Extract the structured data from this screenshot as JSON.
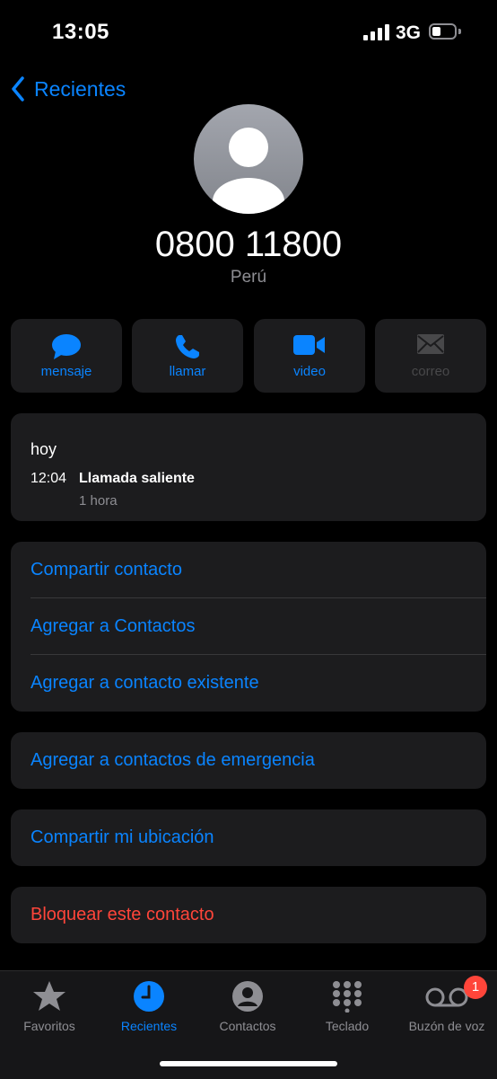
{
  "status_bar": {
    "time": "13:05",
    "network": "3G",
    "battery_level": 0.4
  },
  "nav": {
    "back_label": "Recientes"
  },
  "contact": {
    "number": "0800 11800",
    "country": "Perú"
  },
  "actions": [
    {
      "label": "mensaje",
      "icon": "message-bubble-icon",
      "enabled": true
    },
    {
      "label": "llamar",
      "icon": "phone-icon",
      "enabled": true
    },
    {
      "label": "video",
      "icon": "video-camera-icon",
      "enabled": true
    },
    {
      "label": "correo",
      "icon": "mail-envelope-icon",
      "enabled": false
    }
  ],
  "history": {
    "day": "hoy",
    "time": "12:04",
    "type": "Llamada saliente",
    "duration": "1 hora"
  },
  "options": {
    "share_contact": "Compartir contacto",
    "add_contact": "Agregar a Contactos",
    "add_existing": "Agregar a contacto existente",
    "emergency": "Agregar a contactos de emergencia",
    "share_location": "Compartir mi ubicación",
    "block": "Bloquear este contacto"
  },
  "tabs": [
    {
      "label": "Favoritos",
      "icon": "star-icon",
      "active": false
    },
    {
      "label": "Recientes",
      "icon": "clock-icon",
      "active": true
    },
    {
      "label": "Contactos",
      "icon": "person-circle-icon",
      "active": false
    },
    {
      "label": "Teclado",
      "icon": "keypad-icon",
      "active": false
    },
    {
      "label": "Buzón de voz",
      "icon": "voicemail-icon",
      "active": false,
      "badge": "1"
    }
  ],
  "colors": {
    "accent": "#0a84ff",
    "destructive": "#ff453a",
    "card": "#1c1c1e",
    "background": "#000000"
  }
}
